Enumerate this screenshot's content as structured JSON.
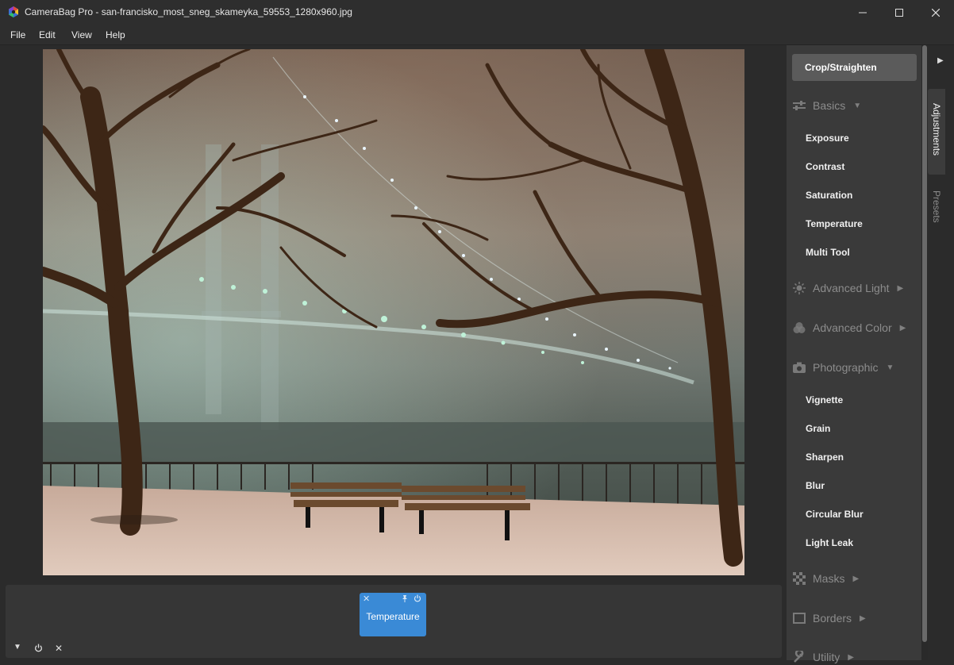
{
  "window": {
    "title": "CameraBag Pro - san-francisko_most_sneg_skameyka_59553_1280x960.jpg",
    "minimize_glyph": "—",
    "maximize_glyph": "☐",
    "close_glyph": "✕"
  },
  "menu": [
    "File",
    "Edit",
    "View",
    "Help"
  ],
  "panel": {
    "crop_label": "Crop/Straighten",
    "sections": {
      "basics": {
        "label": "Basics",
        "icon": "sliders-icon",
        "expanded": true
      },
      "advanced_light": {
        "label": "Advanced Light",
        "icon": "sun-icon",
        "expanded": false
      },
      "advanced_color": {
        "label": "Advanced Color",
        "icon": "color-circles-icon",
        "expanded": false
      },
      "photographic": {
        "label": "Photographic",
        "icon": "camera-icon",
        "expanded": true
      },
      "masks": {
        "label": "Masks",
        "icon": "checkerboard-icon",
        "expanded": false
      },
      "borders": {
        "label": "Borders",
        "icon": "border-frame-icon",
        "expanded": false
      },
      "utility": {
        "label": "Utility",
        "icon": "wrench-icon",
        "expanded": false
      }
    },
    "basics_tools": [
      "Exposure",
      "Contrast",
      "Saturation",
      "Temperature",
      "Multi Tool"
    ],
    "photographic_tools": [
      "Vignette",
      "Grain",
      "Sharpen",
      "Blur",
      "Circular Blur",
      "Light Leak"
    ],
    "arrows": {
      "expanded": "▼",
      "collapsed": "▶"
    }
  },
  "side_tabs": {
    "adjustments": "Adjustments",
    "presets": "Presets",
    "collapse_glyph": "▶"
  },
  "adjustment_strip": {
    "chip": {
      "label": "Temperature",
      "close_glyph": "✕"
    },
    "controls": {
      "collapse_glyph": "▼",
      "close_glyph": "✕"
    }
  },
  "colors": {
    "accent": "#3a8ad6",
    "panel": "#3a3a3a",
    "background": "#2b2b2b"
  }
}
